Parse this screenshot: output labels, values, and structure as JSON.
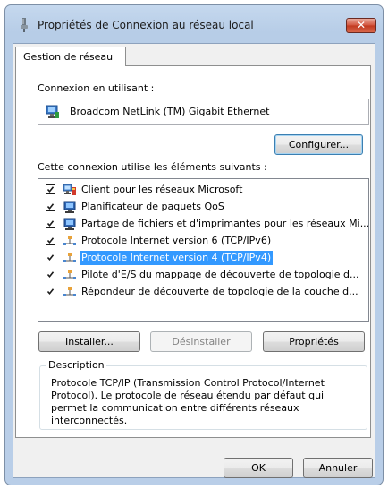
{
  "window": {
    "title": "Propriétés de Connexion au réseau local",
    "close_label": "✕"
  },
  "tab": {
    "label": "Gestion de réseau"
  },
  "connect_using": {
    "label": "Connexion en utilisant :",
    "adapter": "Broadcom NetLink (TM) Gigabit Ethernet",
    "configure_button": "Configurer..."
  },
  "items": {
    "label": "Cette connexion utilise les éléments suivants :",
    "list": [
      {
        "text": "Client pour les réseaux Microsoft",
        "checked": true,
        "icon": "network-client-icon"
      },
      {
        "text": "Planificateur de paquets QoS",
        "checked": true,
        "icon": "network-service-icon"
      },
      {
        "text": "Partage de fichiers et d'imprimantes pour les réseaux Mi...",
        "checked": true,
        "icon": "network-service-icon"
      },
      {
        "text": "Protocole Internet version 6 (TCP/IPv6)",
        "checked": true,
        "icon": "protocol-icon"
      },
      {
        "text": "Protocole Internet version 4 (TCP/IPv4)",
        "checked": true,
        "icon": "protocol-icon",
        "selected": true
      },
      {
        "text": "Pilote d'E/S du mappage de découverte de topologie d...",
        "checked": true,
        "icon": "protocol-icon"
      },
      {
        "text": "Répondeur de découverte de topologie de la couche d...",
        "checked": true,
        "icon": "protocol-icon"
      }
    ]
  },
  "buttons": {
    "install": "Installer...",
    "uninstall": "Désinstaller",
    "properties": "Propriétés",
    "ok": "OK",
    "cancel": "Annuler"
  },
  "description": {
    "legend": "Description",
    "text": "Protocole TCP/IP (Transmission Control Protocol/Internet Protocol). Le protocole de réseau étendu par défaut qui permet la communication entre différents réseaux interconnectés."
  },
  "colors": {
    "selection": "#3399ff",
    "titlebar": "#b9cee8",
    "close": "#c0391f"
  }
}
